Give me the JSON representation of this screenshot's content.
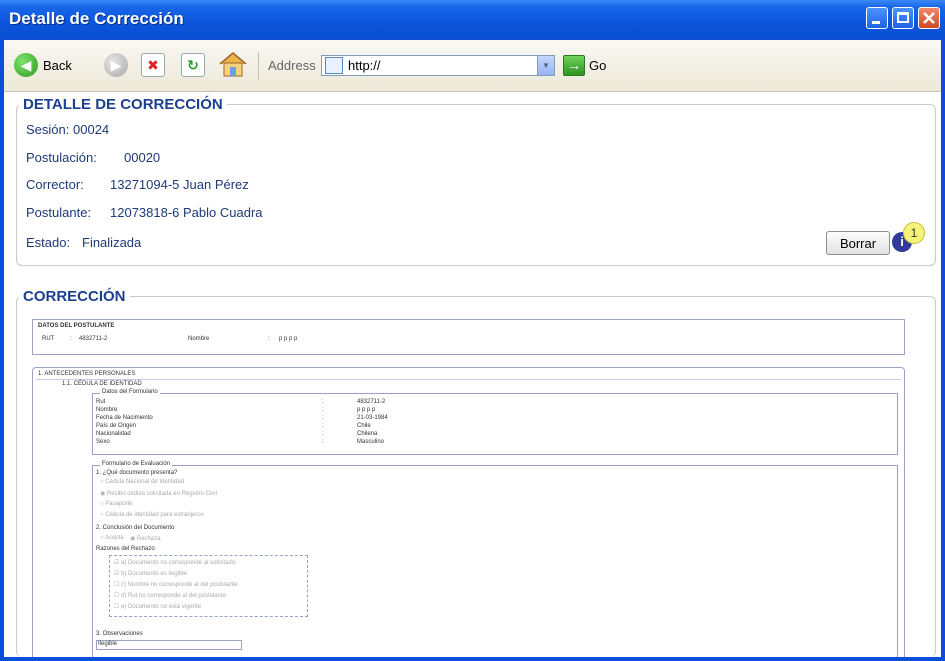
{
  "window": {
    "title": "Detalle de Corrección"
  },
  "toolbar": {
    "back_label": "Back",
    "address_label": "Address",
    "address_value": "http://",
    "go_label": "Go"
  },
  "detalle": {
    "legend": "DETALLE DE CORRECCIÓN",
    "sesion_label": "Sesión:",
    "sesion_value": "00024",
    "postulacion_label": "Postulación:",
    "postulacion_value": "00020",
    "corrector_label": "Corrector:",
    "corrector_value": "13271094-5 Juan Pérez",
    "postulante_label": "Postulante:",
    "postulante_value": "12073818-6 Pablo Cuadra",
    "estado_label": "Estado:",
    "estado_value": "Finalizada",
    "borrar_label": "Borrar",
    "badge_count": "1",
    "info_glyph": "i"
  },
  "correccion": {
    "legend": "CORRECCIÓN",
    "datos_postulante_title": "DATOS DEL POSTULANTE",
    "rut_label": "RUT",
    "rut_value": "4832711-2",
    "nombre_label": "Nombre",
    "nombre_value": "p p p p",
    "sep": ":",
    "antecedentes_title": "1. ANTECEDENTES PERSONALES",
    "cedula_title": "1.1. CÉDULA DE IDENTIDAD",
    "datos_formulario_title": "Datos del Formulario",
    "form_rows": [
      {
        "label": "Rut",
        "value": "4832711-2"
      },
      {
        "label": "Nombre",
        "value": "p p p p"
      },
      {
        "label": "Fecha de Nacimiento",
        "value": "21-03-1984"
      },
      {
        "label": "País de Origen",
        "value": "Chile"
      },
      {
        "label": "Nacionalidad",
        "value": "Chilena"
      },
      {
        "label": "Sexo",
        "value": "Masculino"
      }
    ],
    "eval_title": "Formulario de Evaluación",
    "q1": "1. ¿Qué documento presenta?",
    "q1_options": [
      "Cédula Nacional de Identidad",
      "Recibo cédula solicitada en Registro Civil",
      "Pasaporte",
      "Cédula de identidad para extranjeros"
    ],
    "q2": "2. Conclusión del Documento",
    "q2_options": [
      "Acepta",
      "Rechaza"
    ],
    "reasons_title": "Razones del Rechazo",
    "reasons": [
      "a) Documento no corresponde al solicitado",
      "b) Documento es ilegible",
      "c) Nombre no corresponde al del postulante",
      "d) Rut no corresponde al del postulante",
      "e) Documento no está vigente"
    ],
    "q3": "3. Observaciones",
    "q3_value": "Ilegible"
  }
}
